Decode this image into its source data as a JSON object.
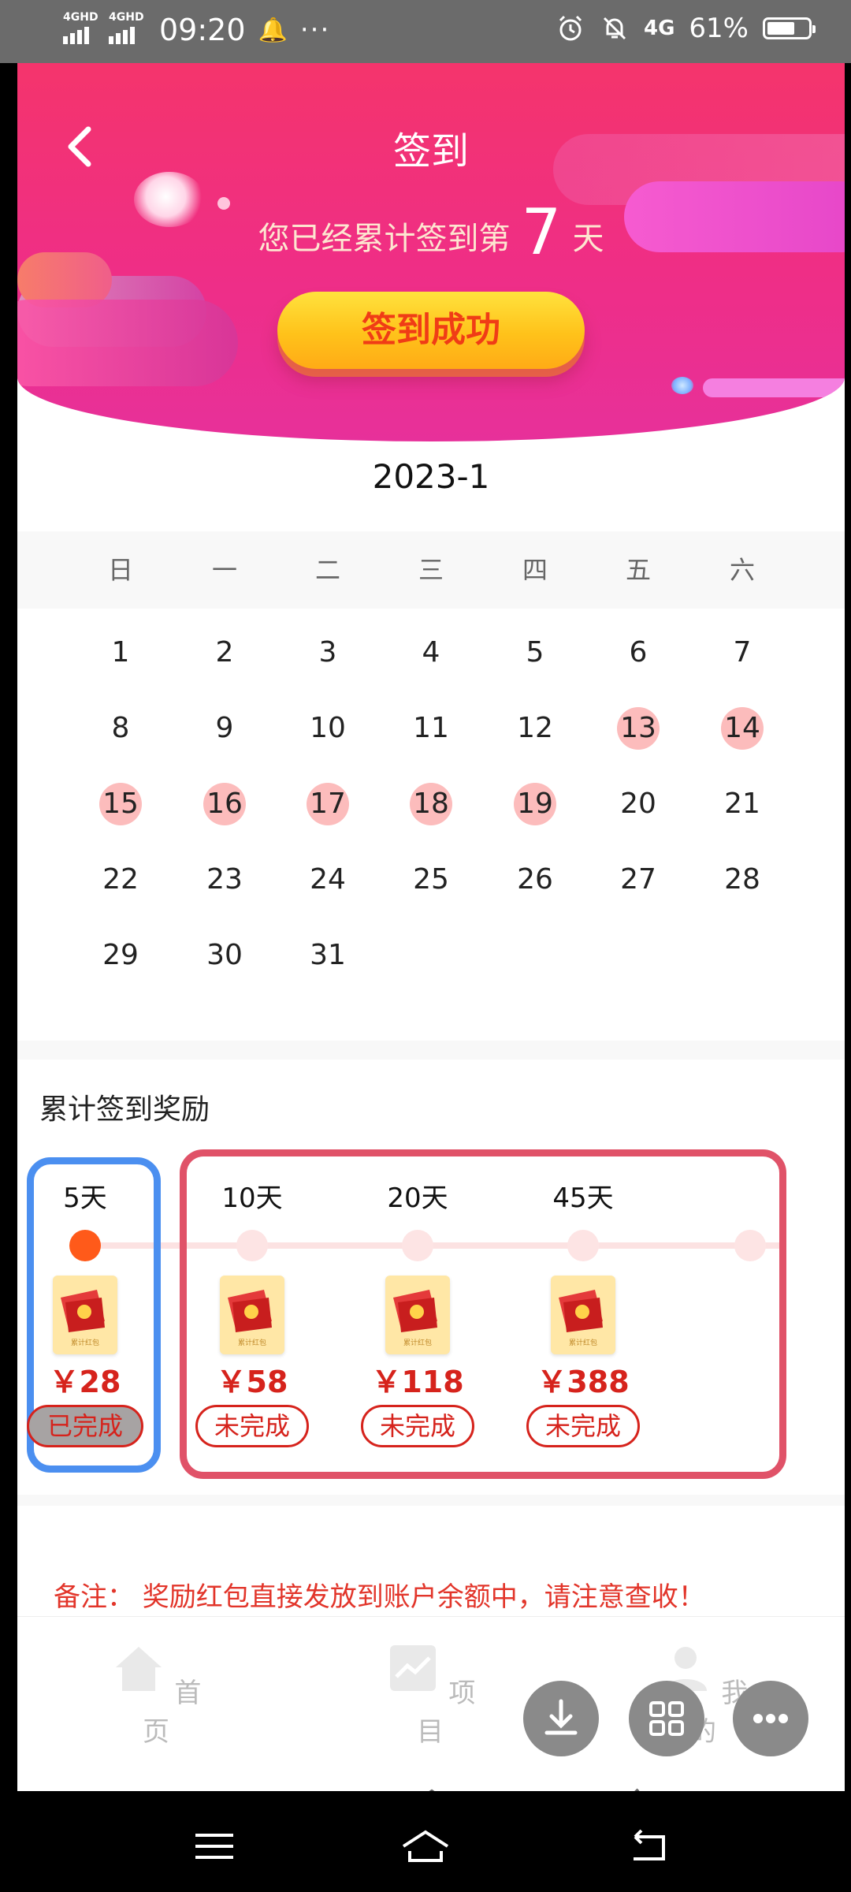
{
  "status_bar": {
    "signal1": "4GHD",
    "signal2": "4GHD",
    "time": "09:20",
    "more": "···",
    "network": "4G",
    "battery": "61%"
  },
  "header": {
    "title": "签到",
    "streak_prefix": "您已经累计签到第",
    "streak_days": "7",
    "streak_suffix": "天",
    "signin_button": "签到成功"
  },
  "calendar": {
    "month": "2023-1",
    "weekdays": [
      "日",
      "一",
      "二",
      "三",
      "四",
      "五",
      "六"
    ],
    "weeks": [
      [
        "1",
        "2",
        "3",
        "4",
        "5",
        "6",
        "7"
      ],
      [
        "8",
        "9",
        "10",
        "11",
        "12",
        "13",
        "14"
      ],
      [
        "15",
        "16",
        "17",
        "18",
        "19",
        "20",
        "21"
      ],
      [
        "22",
        "23",
        "24",
        "25",
        "26",
        "27",
        "28"
      ],
      [
        "29",
        "30",
        "31"
      ]
    ],
    "signed_days": [
      13,
      14,
      15,
      16,
      17,
      18,
      19
    ]
  },
  "rewards": {
    "title": "累计签到奖励",
    "items": [
      {
        "days": "5天",
        "amount": "￥28",
        "status": "已完成",
        "completed": true
      },
      {
        "days": "10天",
        "amount": "￥58",
        "status": "未完成",
        "completed": false
      },
      {
        "days": "20天",
        "amount": "￥118",
        "status": "未完成",
        "completed": false
      },
      {
        "days": "45天",
        "amount": "￥388",
        "status": "未完成",
        "completed": false
      }
    ],
    "envelope_label": "累计红包",
    "note": "备注：  奖励红包直接发放到账户余额中，请注意查收！"
  },
  "tabbar": {
    "home": "首页",
    "project": "项目",
    "mine": "我的"
  },
  "colors": {
    "header_gradient_start": "#f4346c",
    "header_gradient_end": "#e7309a",
    "signed_day": "#fcbcbc",
    "completed_frame": "#4b8ff0",
    "pending_frame": "#e05268",
    "reward_red": "#d6231c",
    "progress_active": "#ff5a1a"
  }
}
